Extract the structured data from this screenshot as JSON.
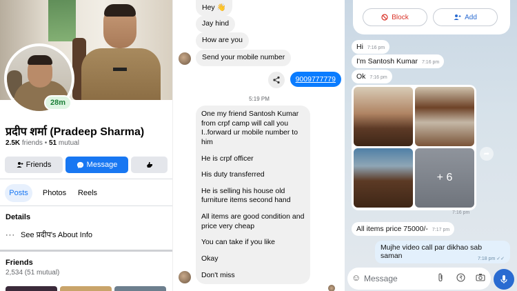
{
  "profile": {
    "name": "प्रदीप शर्मा (Pradeep Sharma)",
    "friends_count": "2.5K",
    "friends_word": "friends",
    "dot": "•",
    "mutual_count": "51",
    "mutual_word": "mutual",
    "story_badge": "28m",
    "buttons": {
      "friends": "Friends",
      "message": "Message"
    },
    "tabs": [
      "Posts",
      "Photos",
      "Reels"
    ],
    "details_heading": "Details",
    "about_info": "See प्रदीप's About Info",
    "friends_heading": "Friends",
    "friends_sub": "2,534 (51 mutual)",
    "colors": {
      "accent": "#1877f2",
      "badge_green": "#1a7f37"
    }
  },
  "messenger": {
    "messages_in_top": [
      "Hey 👋",
      "Jay hind",
      "How are you",
      "Send your mobile number"
    ],
    "outgoing_number": "9009777779",
    "timestamp": "5:19 PM",
    "long_messages": [
      "One my friend Santosh Kumar from crpf camp will call you I..forward ur mobile number to him",
      "He is crpf officer",
      "His duty transferred",
      "He is selling his house old furniture items second hand",
      "All items are good condition and price very cheap",
      "You can take if you like",
      "Okay",
      "Don't miss"
    ],
    "colors": {
      "outgoing": "#0a7cff",
      "incoming": "#f0f0f0"
    }
  },
  "telegram": {
    "block_label": "Block",
    "add_label": "Add",
    "messages": [
      {
        "text": "Hi",
        "time": "7:16 pm"
      },
      {
        "text": "I'm Santosh Kumar",
        "time": "7:16 pm"
      },
      {
        "text": "Ok",
        "time": "7:16 pm"
      }
    ],
    "photo_more": "+ 6",
    "photos_time": "7:16 pm",
    "price_msg": {
      "text": "All items price 75000/-",
      "time": "7:17 pm"
    },
    "outgoing": {
      "text": "Mujhe video call par dikhao sab saman",
      "time": "7:18 pm"
    },
    "composer_placeholder": "Message",
    "colors": {
      "accent": "#2a6bd1",
      "block_red": "#d93025"
    }
  }
}
